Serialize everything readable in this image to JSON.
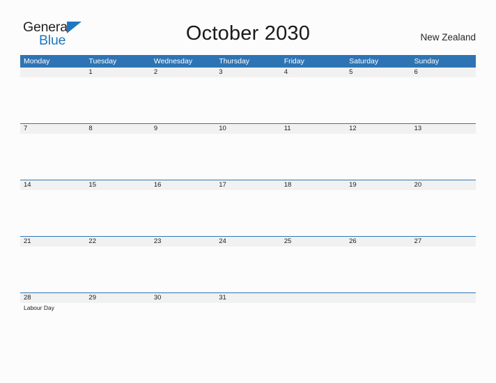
{
  "brand": {
    "word_one": "General",
    "word_two": "Blue",
    "mark": "triangle-logo-icon",
    "accent_color": "#1f77bf"
  },
  "header": {
    "title": "October 2030",
    "country": "New Zealand"
  },
  "theme": {
    "header_blue": "#2e74b5",
    "row_band": "#f1f1f1",
    "page_background": "#fcfcfc",
    "text": "#1a1a1a"
  },
  "calendar": {
    "weekday_headers": [
      "Monday",
      "Tuesday",
      "Wednesday",
      "Thursday",
      "Friday",
      "Saturday",
      "Sunday"
    ],
    "weeks": [
      {
        "days": [
          {
            "number": "",
            "events": []
          },
          {
            "number": "1",
            "events": []
          },
          {
            "number": "2",
            "events": []
          },
          {
            "number": "3",
            "events": []
          },
          {
            "number": "4",
            "events": []
          },
          {
            "number": "5",
            "events": []
          },
          {
            "number": "6",
            "events": []
          }
        ]
      },
      {
        "days": [
          {
            "number": "7",
            "events": []
          },
          {
            "number": "8",
            "events": []
          },
          {
            "number": "9",
            "events": []
          },
          {
            "number": "10",
            "events": []
          },
          {
            "number": "11",
            "events": []
          },
          {
            "number": "12",
            "events": []
          },
          {
            "number": "13",
            "events": []
          }
        ]
      },
      {
        "days": [
          {
            "number": "14",
            "events": []
          },
          {
            "number": "15",
            "events": []
          },
          {
            "number": "16",
            "events": []
          },
          {
            "number": "17",
            "events": []
          },
          {
            "number": "18",
            "events": []
          },
          {
            "number": "19",
            "events": []
          },
          {
            "number": "20",
            "events": []
          }
        ]
      },
      {
        "days": [
          {
            "number": "21",
            "events": []
          },
          {
            "number": "22",
            "events": []
          },
          {
            "number": "23",
            "events": []
          },
          {
            "number": "24",
            "events": []
          },
          {
            "number": "25",
            "events": []
          },
          {
            "number": "26",
            "events": []
          },
          {
            "number": "27",
            "events": []
          }
        ]
      },
      {
        "days": [
          {
            "number": "28",
            "events": [
              "Labour Day"
            ]
          },
          {
            "number": "29",
            "events": []
          },
          {
            "number": "30",
            "events": []
          },
          {
            "number": "31",
            "events": []
          },
          {
            "number": "",
            "events": []
          },
          {
            "number": "",
            "events": []
          },
          {
            "number": "",
            "events": []
          }
        ]
      }
    ]
  }
}
